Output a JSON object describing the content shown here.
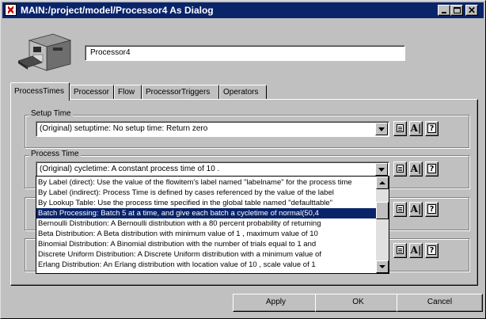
{
  "window": {
    "title": "MAIN:/project/model/Processor4 As Dialog",
    "controls": {
      "minimize": "minimize-icon",
      "maximize": "maximize-icon",
      "close": "close-icon"
    }
  },
  "object": {
    "icon": "processor-machine-icon",
    "name": "Processor4"
  },
  "tabs": [
    {
      "label": "ProcessTimes",
      "active": true
    },
    {
      "label": "Processor"
    },
    {
      "label": "Flow"
    },
    {
      "label": "ProcessorTriggers"
    },
    {
      "label": "Operators"
    }
  ],
  "setup_time": {
    "label": "Setup Time",
    "value": "(Original) setuptime:  No setup time: Return zero"
  },
  "process_time": {
    "label": "Process Time",
    "value": "(Original) cycletime:  A constant process time of 10  ."
  },
  "dropdown_options": [
    "By Label (direct):  Use the value of the flowitem's label named  \"labelname\"  for the process time",
    "By Label (indirect):  Process Time is defined by cases referenced by the value of the label",
    "By Lookup Table:  Use the process time specified in the global table named \"defaulttable\"",
    "Batch Processing:  Batch 5   at a time, and give each batch a cycletime of normal(50,4",
    "Bernoulli Distribution:  A Bernoulli distribution with a 80   percent probability of returning",
    "Beta Distribution:  A Beta distribution with minimum value of 1  , maximum value of 10",
    "Binomial Distribution:  A Binomial distribution with the number of trials equal to 1   and",
    "Discrete Uniform Distribution:  A Discrete Uniform distribution with a minimum value of",
    "Erlang Distribution:  An Erlang distribution with location value of 10  , scale value of 1"
  ],
  "selected_option_index": 3,
  "buttons": {
    "apply": "Apply",
    "ok": "OK",
    "cancel": "Cancel"
  }
}
